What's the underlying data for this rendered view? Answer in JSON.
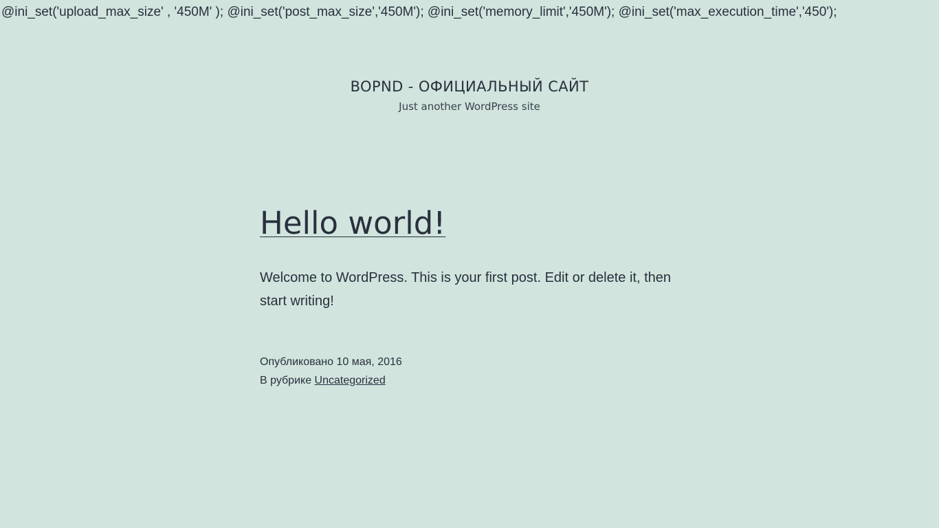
{
  "php_notice": "@ini_set('upload_max_size' , '450M' ); @ini_set('post_max_size','450M'); @ini_set('memory_limit','450M'); @ini_set('max_execution_time','450');",
  "header": {
    "site_title": "BOPND - ОФИЦИАЛЬНЫЙ САЙТ",
    "site_description": "Just another WordPress site"
  },
  "post": {
    "title": "Hello world!",
    "content": "Welcome to WordPress. This is your first post. Edit or delete it, then start writing!",
    "posted_label": "Опубликовано",
    "date": "10 мая, 2016",
    "category_label": "В рубрике",
    "category": "Uncategorized"
  },
  "colors": {
    "background": "#d1e4dd",
    "text": "#28303d"
  }
}
